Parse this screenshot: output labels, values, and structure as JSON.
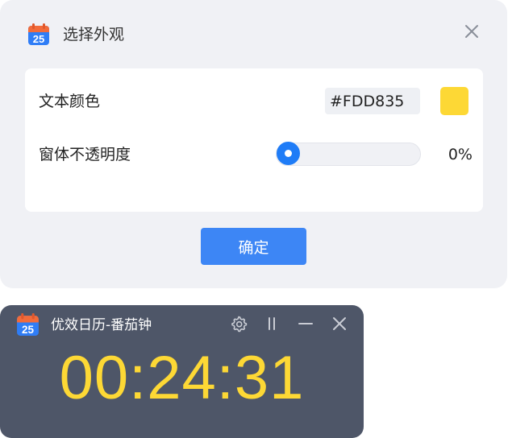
{
  "dialog": {
    "title": "选择外观",
    "icon": "calendar-icon",
    "icon_date": "25",
    "close_icon": "close-icon",
    "text_color_label": "文本颜色",
    "text_color_value": "#FDD835",
    "opacity_label": "窗体不透明度",
    "opacity_value_text": "0%",
    "opacity_fraction": 0.0,
    "confirm_label": "确定"
  },
  "timer": {
    "title": "优效日历-番茄钟",
    "icon": "calendar-icon",
    "icon_date": "25",
    "time": "00:24:31",
    "buttons": [
      "gear-icon",
      "pause-icon",
      "minimize-icon",
      "close-icon"
    ]
  },
  "colors": {
    "accent": "#3d86f5",
    "timer_background": "#4e5668",
    "timer_text": "#fdd835",
    "dialog_background": "#f0f1f5"
  }
}
